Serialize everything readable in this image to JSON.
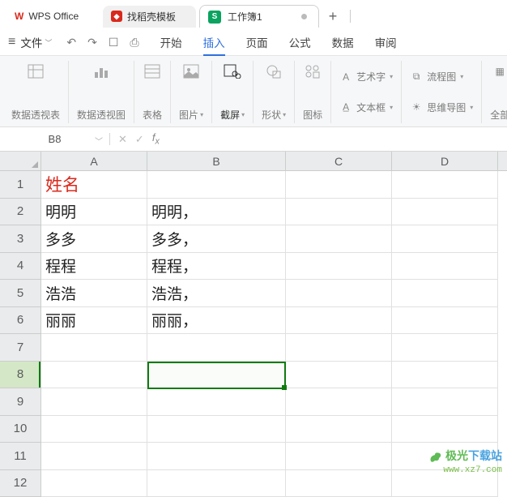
{
  "tabs": {
    "app_name": "WPS Office",
    "docer": "找稻壳模板",
    "book": "工作簿1",
    "plus": "+"
  },
  "menubar": {
    "file": "文件",
    "items": [
      "开始",
      "插入",
      "页面",
      "公式",
      "数据",
      "审阅"
    ],
    "active_index": 1
  },
  "ribbon": {
    "pivot_table": "数据透视表",
    "pivot_chart": "数据透视图",
    "table": "表格",
    "picture": "图片",
    "screenshot": "截屏",
    "shape": "形状",
    "icon": "图标",
    "wordart": "艺术字",
    "textbox": "文本框",
    "flowchart": "流程图",
    "mindmap": "思维导图",
    "all": "全部"
  },
  "namebox": "B8",
  "formula": "",
  "columns": [
    "A",
    "B",
    "C",
    "D"
  ],
  "row_nums": [
    "1",
    "2",
    "3",
    "4",
    "5",
    "6",
    "7",
    "8",
    "9",
    "10",
    "11",
    "12"
  ],
  "selected_row": 8,
  "chart_data": {
    "type": "table",
    "columns": [
      "A",
      "B"
    ],
    "rows": [
      [
        "姓名",
        ""
      ],
      [
        "明明",
        "明明，"
      ],
      [
        "多多",
        "多多，"
      ],
      [
        "程程",
        "程程，"
      ],
      [
        "浩浩",
        "浩浩，"
      ],
      [
        "丽丽",
        "丽丽，"
      ]
    ]
  },
  "watermark": {
    "l1a": "极光",
    "l1b": "下载站",
    "l2": "www.xz7.com"
  }
}
